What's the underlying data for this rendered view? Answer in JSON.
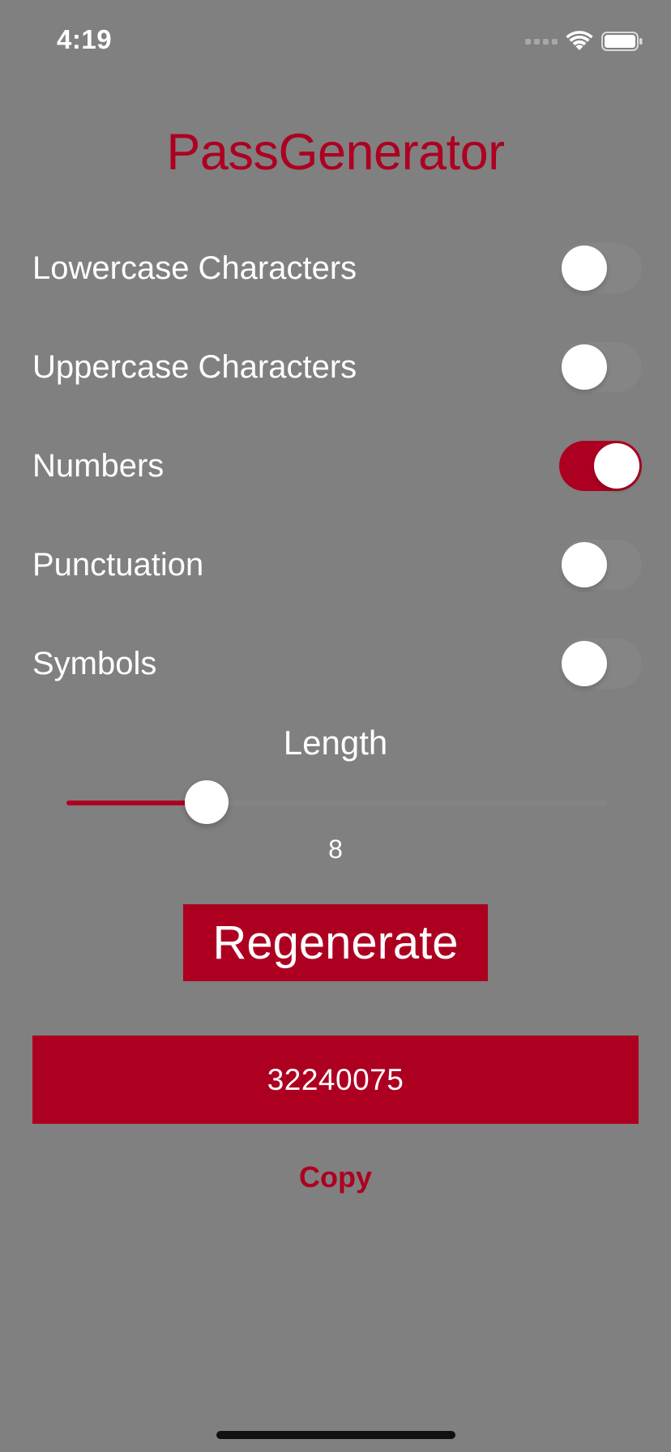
{
  "status_bar": {
    "time": "4:19",
    "signal_icon": "cellular-signal-dots",
    "wifi_icon": "wifi",
    "battery_icon": "battery-full"
  },
  "app": {
    "title": "PassGenerator",
    "accent_color": "#ad0021",
    "background_color": "#808080"
  },
  "options": [
    {
      "label": "Lowercase Characters",
      "enabled": false
    },
    {
      "label": "Uppercase Characters",
      "enabled": false
    },
    {
      "label": "Numbers",
      "enabled": true
    },
    {
      "label": "Punctuation",
      "enabled": false
    },
    {
      "label": "Symbols",
      "enabled": false
    }
  ],
  "length": {
    "label": "Length",
    "value": "8",
    "slider_fraction": 0.26
  },
  "regenerate": {
    "label": "Regenerate"
  },
  "password": {
    "value": "32240075"
  },
  "copy": {
    "label": "Copy"
  }
}
